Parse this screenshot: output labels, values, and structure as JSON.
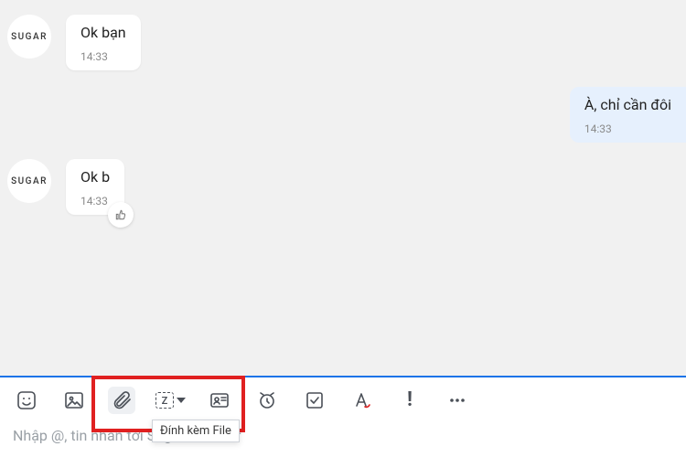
{
  "contact": {
    "avatar_text": "SUGAR"
  },
  "messages": [
    {
      "side": "left",
      "text": "Ok bạn",
      "time": "14:33"
    },
    {
      "side": "right",
      "text": "À, chỉ cần đôi",
      "time": "14:33"
    },
    {
      "side": "left",
      "text": "Ok b",
      "time": "14:33",
      "like": true
    }
  ],
  "toolbar": {
    "tooltip": "Đính kèm File"
  },
  "composer": {
    "placeholder": "Nhập @, tin nhắn tới Sugar Sneaker"
  }
}
